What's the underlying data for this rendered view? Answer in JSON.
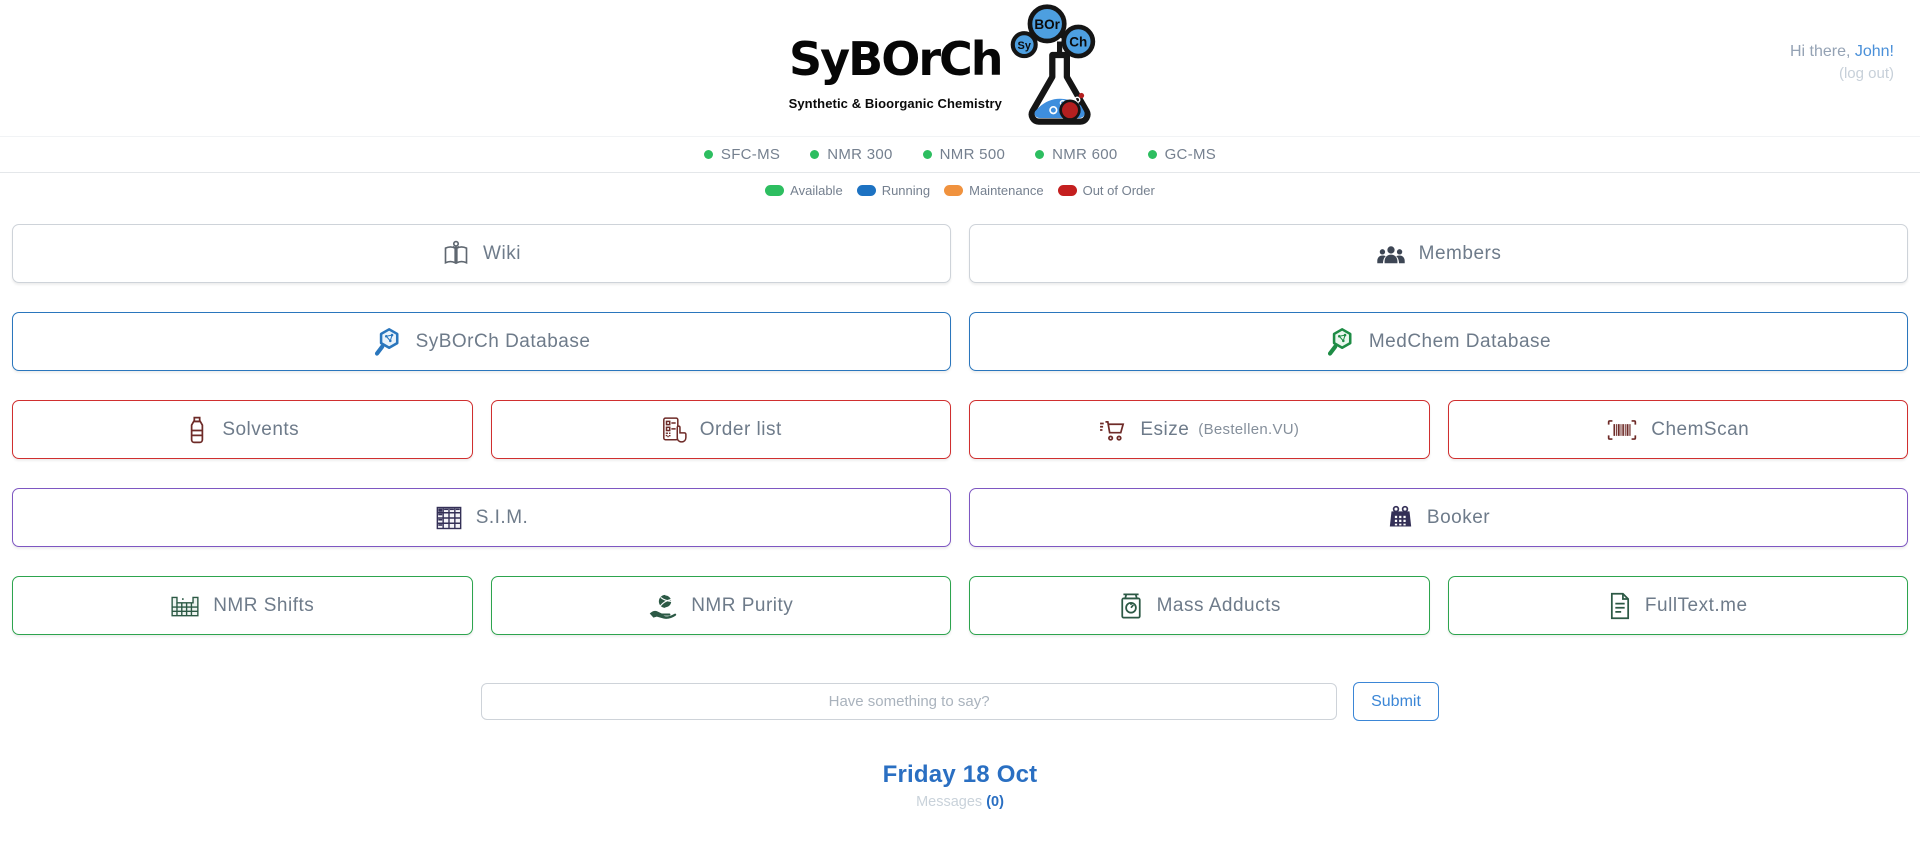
{
  "header": {
    "logo": {
      "title": "SyBOrCh",
      "subtitle": "Synthetic & Bioorganic Chemistry",
      "bubbles": [
        "Sy",
        "BOr",
        "Ch"
      ]
    },
    "greeting": {
      "prefix": "Hi there, ",
      "name": "John!",
      "logout": "(log out)"
    }
  },
  "instruments": {
    "items": [
      {
        "name": "SFC-MS",
        "status": "available"
      },
      {
        "name": "NMR 300",
        "status": "available"
      },
      {
        "name": "NMR 500",
        "status": "available"
      },
      {
        "name": "NMR 600",
        "status": "available"
      },
      {
        "name": "GC-MS",
        "status": "available"
      }
    ]
  },
  "legend": {
    "items": [
      {
        "label": "Available",
        "color": "#2dbe60"
      },
      {
        "label": "Running",
        "color": "#1d72c2"
      },
      {
        "label": "Maintenance",
        "color": "#f0923e"
      },
      {
        "label": "Out of Order",
        "color": "#c41f1f"
      }
    ]
  },
  "tiles": {
    "wiki": {
      "label": "Wiki"
    },
    "members": {
      "label": "Members"
    },
    "syborch_db": {
      "label": "SyBOrCh Database"
    },
    "medchem_db": {
      "label": "MedChem Database"
    },
    "solvents": {
      "label": "Solvents"
    },
    "order_list": {
      "label": "Order list"
    },
    "esize": {
      "label": "Esize",
      "sublabel": "(Bestellen.VU)"
    },
    "chemscan": {
      "label": "ChemScan"
    },
    "sim": {
      "label": "S.I.M."
    },
    "booker": {
      "label": "Booker"
    },
    "nmr_shifts": {
      "label": "NMR Shifts"
    },
    "nmr_purity": {
      "label": "NMR Purity"
    },
    "mass_adducts": {
      "label": "Mass Adducts"
    },
    "fulltext": {
      "label": "FullText.me"
    }
  },
  "composer": {
    "placeholder": "Have something to say?",
    "submit_label": "Submit"
  },
  "footer": {
    "date": "Friday 18 Oct",
    "messages_label": "Messages ",
    "messages_count": "(0)"
  },
  "colors": {
    "row_default_border": "#ced3d9",
    "row_database_border": "#2a76bd",
    "row_orders_border": "#d02f2f",
    "row_booking_border": "#7e57c2",
    "row_analysis_border": "#2da44e",
    "accent_blue": "#2a6fc2",
    "status_available": "#2dbe60"
  }
}
